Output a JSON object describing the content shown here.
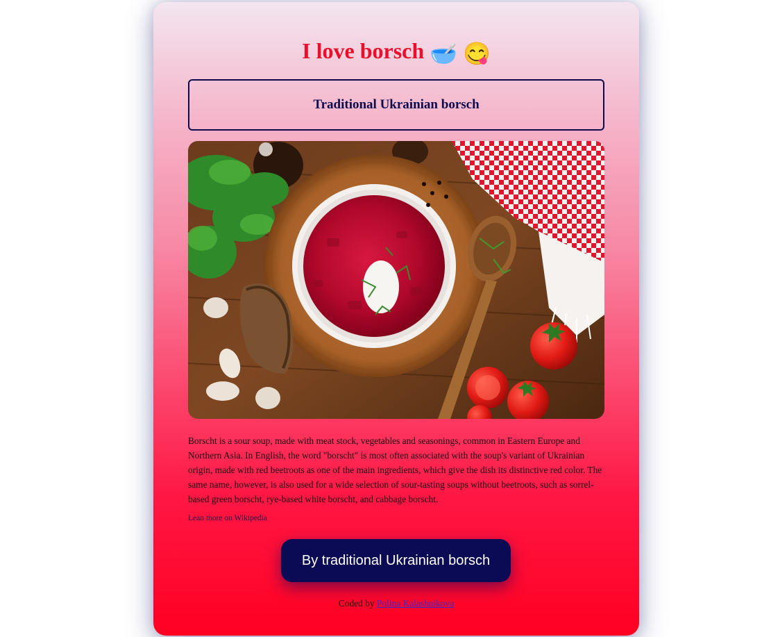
{
  "header": {
    "title": "I love borsch",
    "emoji_1": "🥣",
    "emoji_2": "😋"
  },
  "subtitle": "Traditional Ukrainian borsch",
  "image": {
    "icon": "borsch-photo"
  },
  "description": "Borscht is a sour soup, made with meat stock, vegetables and seasonings, common in Eastern Europe and Northern Asia. In English, the word \"borscht\" is most often associated with the soup's variant of Ukrainian origin, made with red beetroots as one of the main ingredients, which give the dish its distinctive red color. The same name, however, is also used for a wide selection of sour-tasting soups without beetroots, such as sorrel-based green borscht, rye-based white borscht, and cabbage borscht.",
  "wiki_link": "Lean more on Wikipedia",
  "buy_button": "By traditional Ukrainian borsch",
  "footer": {
    "prefix": "Coded by",
    "author": "Polina Kalashnikova"
  },
  "colors": {
    "title": "#e8112d",
    "accent_dark": "#0b0a55"
  }
}
